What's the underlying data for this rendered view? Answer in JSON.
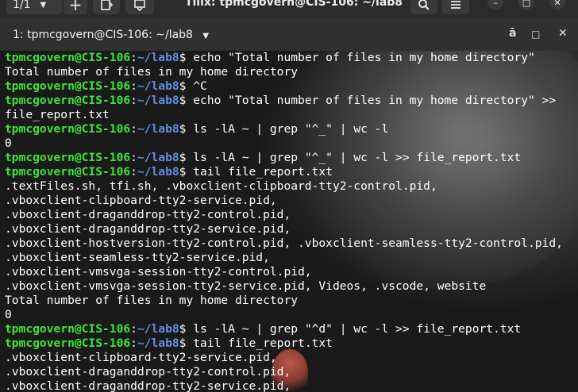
{
  "header": {
    "session_label": "1/1",
    "window_title": "Tilix: tpmcgovern@CIS-106: ~/lab8",
    "icons": {
      "session_caret": "chevron-down-icon",
      "add": "plus-icon",
      "split_right": "split-right-icon",
      "split_down": "split-down-icon",
      "search": "search-icon",
      "menu": "hamburger-menu-icon",
      "minimize": "minimize-icon",
      "maximize": "maximize-icon",
      "close": "close-icon"
    }
  },
  "terminal_bar": {
    "title": "1: tpmcgovern@CIS-106: ~/lab8",
    "icons": {
      "caret": "chevron-down-icon",
      "sync": "sync-input-icon",
      "maximize": "maximize-icon",
      "close": "close-icon"
    }
  },
  "prompt": {
    "user": "tpmcgovern@CIS-106",
    "path": "~/lab8"
  },
  "lines": [
    {
      "type": "cmd",
      "text": "$ echo \"Total number of files in my home directory\""
    },
    {
      "type": "out",
      "text": "Total number of files in my home directory"
    },
    {
      "type": "cmd",
      "text": "$ ^C"
    },
    {
      "type": "cmd",
      "text": "$ echo \"Total number of files in my home directory\" >>"
    },
    {
      "type": "out",
      "text": "file_report.txt"
    },
    {
      "type": "cmd",
      "text": "$ ls -lA ~ | grep \"^_\" | wc -l"
    },
    {
      "type": "out",
      "text": "0"
    },
    {
      "type": "cmd",
      "text": "$ ls -lA ~ | grep \"^_\" | wc -l >> file_report.txt"
    },
    {
      "type": "cmd",
      "text": "$ tail file_report.txt"
    },
    {
      "type": "out",
      "text": ".textFiles.sh, tfi.sh, .vboxclient-clipboard-tty2-control.pid,"
    },
    {
      "type": "out",
      "text": ".vboxclient-clipboard-tty2-service.pid,"
    },
    {
      "type": "out",
      "text": ".vboxclient-draganddrop-tty2-control.pid,"
    },
    {
      "type": "out",
      "text": ".vboxclient-draganddrop-tty2-service.pid,"
    },
    {
      "type": "out",
      "text": ".vboxclient-hostversion-tty2-control.pid, .vboxclient-seamless-tty2-control.pid,"
    },
    {
      "type": "out",
      "text": ".vboxclient-seamless-tty2-service.pid,"
    },
    {
      "type": "out",
      "text": ".vboxclient-vmsvga-session-tty2-control.pid,"
    },
    {
      "type": "out",
      "text": ".vboxclient-vmsvga-session-tty2-service.pid, Videos, .vscode, website"
    },
    {
      "type": "out",
      "text": "Total number of files in my home directory"
    },
    {
      "type": "out",
      "text": "0"
    },
    {
      "type": "cmd",
      "text": "$ ls -lA ~ | grep \"^d\" | wc -l >> file_report.txt"
    },
    {
      "type": "cmd",
      "text": "$ tail file_report.txt"
    },
    {
      "type": "out",
      "text": ".vboxclient-clipboard-tty2-service.pid,"
    },
    {
      "type": "out",
      "text": ".vboxclient-draganddrop-tty2-control.pid,"
    },
    {
      "type": "out",
      "text": ".vboxclient-draganddrop-tty2-service.pid,"
    }
  ]
}
